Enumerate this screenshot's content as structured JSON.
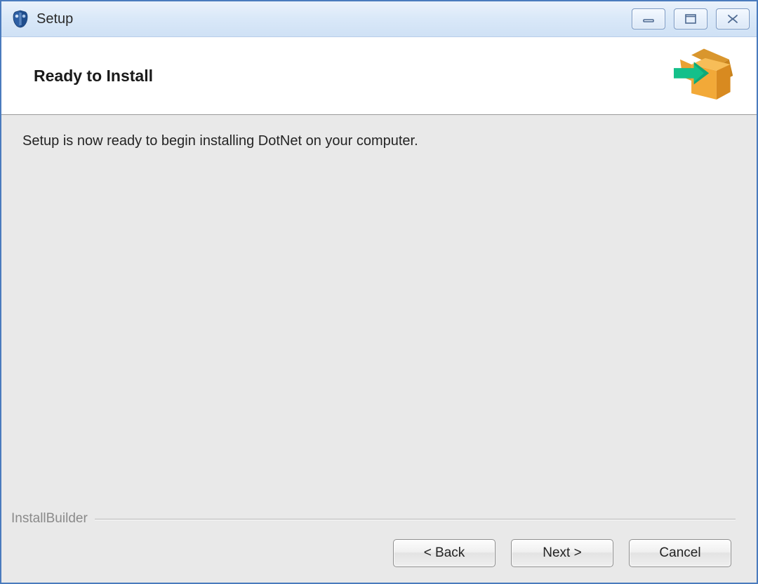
{
  "window": {
    "title": "Setup"
  },
  "header": {
    "heading": "Ready to Install"
  },
  "content": {
    "message": "Setup is now ready to begin installing DotNet on your computer."
  },
  "footer": {
    "brand": "InstallBuilder",
    "buttons": {
      "back": "< Back",
      "next": "Next >",
      "cancel": "Cancel"
    }
  }
}
